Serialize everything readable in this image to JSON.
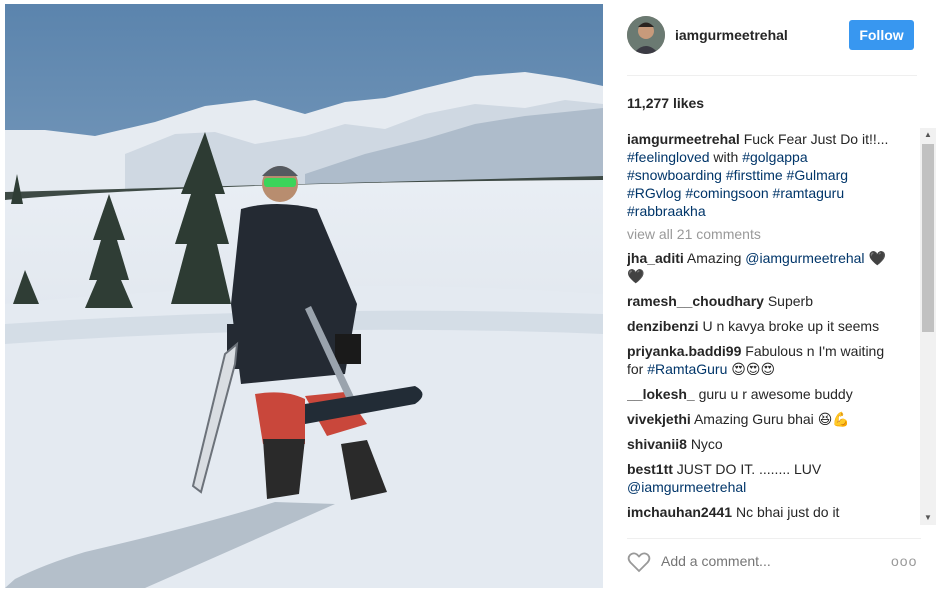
{
  "post": {
    "username": "iamgurmeetrehal",
    "follow_label": "Follow",
    "likes": "11,277 likes",
    "caption": {
      "user": "iamgurmeetrehal",
      "text_1": "Fuck Fear Just Do it!!...",
      "tag_1": "#feelingloved",
      "text_2": "with",
      "tag_2": "#golgappa",
      "tag_3": "#snowboarding",
      "tag_4": "#firsttime",
      "tag_5": "#Gulmarg",
      "tag_6": "#RGvlog",
      "tag_7": "#comingsoon",
      "tag_8": "#ramtaguru",
      "tag_9": "#rabbraakha"
    },
    "view_all": "view all 21 comments",
    "comments": [
      {
        "user": "jha_aditi",
        "pre": "Amazing",
        "mention": "@iamgurmeetrehal",
        "post": "🖤 🖤"
      },
      {
        "user": "ramesh__choudhary",
        "pre": "Superb",
        "mention": "",
        "post": ""
      },
      {
        "user": "denzibenzi",
        "pre": "U n kavya broke up it seems",
        "mention": "",
        "post": ""
      },
      {
        "user": "priyanka.baddi99",
        "pre": "Fabulous n I'm waiting for",
        "mention": "#RamtaGuru",
        "post": "😍😍😍"
      },
      {
        "user": "__lokesh_",
        "pre": "guru u r awesome buddy",
        "mention": "",
        "post": ""
      },
      {
        "user": "vivekjethi",
        "pre": "Amazing Guru bhai",
        "mention": "",
        "post": "😆💪"
      },
      {
        "user": "shivanii8",
        "pre": "Nyco",
        "mention": "",
        "post": ""
      },
      {
        "user": "best1tt",
        "pre": "JUST DO IT. ........ LUV",
        "mention": "@iamgurmeetrehal",
        "post": ""
      },
      {
        "user": "imchauhan2441",
        "pre": "Nc bhai just do it",
        "mention": "",
        "post": ""
      }
    ],
    "add_comment_placeholder": "Add a comment...",
    "more_label": "ooo"
  },
  "colors": {
    "follow_bg": "#3897f0",
    "hashtag": "#003569",
    "muted": "#999999"
  },
  "icons": {
    "heart": "heart-outline-icon",
    "more": "more-options-icon"
  }
}
